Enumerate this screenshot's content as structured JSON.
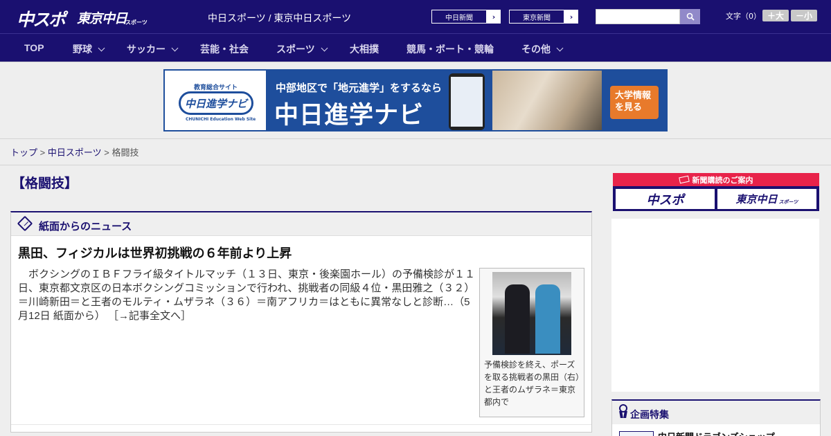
{
  "header": {
    "logo_chuspo": "中スポ",
    "logo_tokyo": "東京中日",
    "logo_tokyo_small": "スポーツ",
    "site_name": "中日スポーツ / 東京中日スポーツ",
    "ext_links": [
      {
        "label": "中日新聞",
        "arrow": "›"
      },
      {
        "label": "東京新聞",
        "arrow": "›"
      }
    ],
    "search": {
      "value": "",
      "placeholder": ""
    },
    "font_size": {
      "label": "文字（0）",
      "larger": "＋大",
      "smaller": "－小"
    }
  },
  "nav": {
    "items": [
      {
        "label": "TOP",
        "dropdown": false
      },
      {
        "label": "野球",
        "dropdown": true
      },
      {
        "label": "サッカー",
        "dropdown": true
      },
      {
        "label": "芸能・社会",
        "dropdown": false
      },
      {
        "label": "スポーツ",
        "dropdown": true
      },
      {
        "label": "大相撲",
        "dropdown": false
      },
      {
        "label": "競馬・ボート・競輪",
        "dropdown": false
      },
      {
        "label": "その他",
        "dropdown": true
      }
    ]
  },
  "banner": {
    "logo_top": "教育総合サイト",
    "logo_name": "中日進学ナビ",
    "logo_sub": "CHUNICHI Education Web Site",
    "line1": "中部地区で「地元進学」をするなら",
    "line2": "中日進学ナビ",
    "cta_line1": "大学情報",
    "cta_line2": "を見る"
  },
  "breadcrumb": {
    "items": [
      "トップ",
      "中日スポーツ"
    ],
    "current": "格闘技",
    "separator": ">"
  },
  "main": {
    "page_title": "【格闘技】",
    "news_section": {
      "title": "紙面からのニュース",
      "article": {
        "title": "黒田、フィジカルは世界初挑戦の６年前より上昇",
        "body": "　ボクシングのＩＢＦフライ級タイトルマッチ（１３日、東京・後楽園ホール）の予備検診が１１日、東京都文京区の日本ボクシングコミッションで行われ、挑戦者の同級４位・黒田雅之（３２）＝川崎新田＝と王者のモルティ・ムザラネ（３６）＝南アフリカ＝はともに異常なしと診断…（5月12日 紙面から）",
        "more": "［→記事全文へ］",
        "photo_caption": "予備検診を終え、ポーズを取る挑戦者の黒田（右）と王者のムザラネ＝東京都内で"
      }
    }
  },
  "sidebar": {
    "subscription": {
      "title": "新聞購読のご案内",
      "btn_chuspo": "中スポ",
      "btn_tokyo": "東京中日",
      "btn_tokyo_small": "スポーツ"
    },
    "feature": {
      "title": "企画特集",
      "item": "中日新聞ドラゴンズショップ"
    }
  }
}
